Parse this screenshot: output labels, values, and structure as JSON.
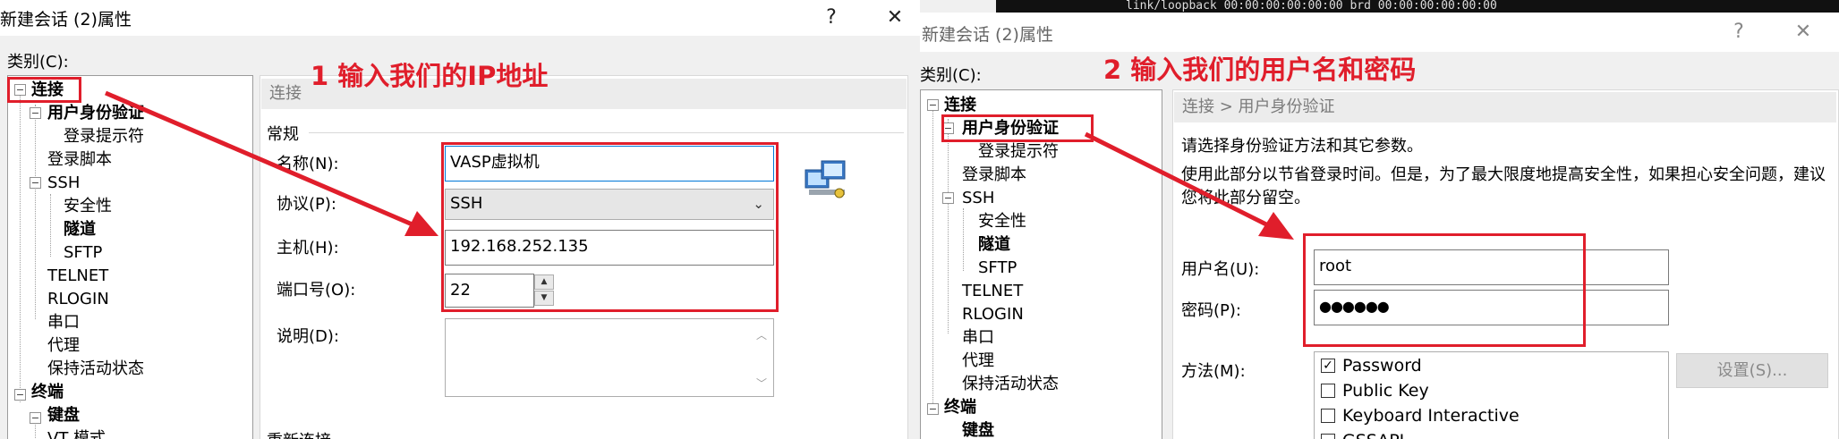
{
  "left_dialog": {
    "title": "新建会话 (2)属性",
    "help_button": "?",
    "close_button": "✕",
    "category_label": "类别(C):",
    "tree_items": [
      "连接",
      "用户身份验证",
      "登录提示符",
      "登录脚本",
      "SSH",
      "安全性",
      "隧道",
      "SFTP",
      "TELNET",
      "RLOGIN",
      "串口",
      "代理",
      "保持活动状态",
      "终端",
      "键盘",
      "VT 模式"
    ],
    "breadcrumb": "连接",
    "group_general": "常规",
    "name_label": "名称(N):",
    "name_value": "VASP虚拟机",
    "protocol_label": "协议(P):",
    "protocol_value": "SSH",
    "host_label": "主机(H):",
    "host_value": "192.168.252.135",
    "port_label": "端口号(O):",
    "port_value": "22",
    "description_label": "说明(D):",
    "reconnect_group": "重新连接",
    "annotation": "1 输入我们的IP地址"
  },
  "right_dialog": {
    "title": "新建会话 (2)属性",
    "background_terminal_text": "link/loopback 00:00:00:00:00:00 brd 00:00:00:00:00:00",
    "help_button": "?",
    "close_button": "✕",
    "category_label": "类别(C):",
    "tree_items": [
      "连接",
      "用户身份验证",
      "登录提示符",
      "登录脚本",
      "SSH",
      "安全性",
      "隧道",
      "SFTP",
      "TELNET",
      "RLOGIN",
      "串口",
      "代理",
      "保持活动状态",
      "终端",
      "键盘"
    ],
    "breadcrumb": "连接 > 用户身份验证",
    "intro": "请选择身份验证方法和其它参数。",
    "hint": "使用此部分以节省登录时间。但是，为了最大限度地提高安全性，如果担心安全问题，建议您将此部分留空。",
    "username_label": "用户名(U):",
    "username_value": "root",
    "password_label": "密码(P):",
    "password_value": "●●●●●●",
    "method_label": "方法(M):",
    "methods": [
      {
        "label": "Password",
        "checked": true
      },
      {
        "label": "Public Key",
        "checked": false
      },
      {
        "label": "Keyboard Interactive",
        "checked": false
      },
      {
        "label": "GSSAPI",
        "checked": false
      }
    ],
    "settings_button": "设置(S)...",
    "annotation": "2 输入我们的用户名和密码"
  },
  "colors": {
    "annotation_red": "#e01e2b",
    "dialog_bg": "#f0f0f0",
    "crumb_bg": "#ececec"
  },
  "icons": [
    "network-computer-icon",
    "tree-toggle-icon",
    "chevron-down-icon",
    "spin-up-icon",
    "spin-down-icon",
    "close-icon",
    "help-icon"
  ]
}
